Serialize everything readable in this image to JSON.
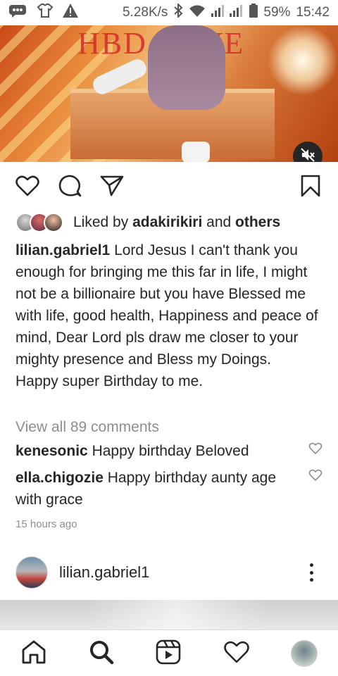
{
  "status_bar": {
    "speed": "5.28K/s",
    "battery": "59%",
    "time": "15:42",
    "icons": [
      "message-icon",
      "shirt-icon",
      "warning-icon",
      "bluetooth-icon",
      "wifi-icon",
      "signal-icon",
      "battery-icon"
    ]
  },
  "post": {
    "overlay_text": "HBD LOVE",
    "mute_icon": "volume-off-icon",
    "actions": {
      "like_icon": "heart-icon",
      "comment_icon": "comment-icon",
      "share_icon": "send-icon",
      "save_icon": "bookmark-icon"
    },
    "likes": {
      "prefix": "Liked by",
      "user": "adakirikiri",
      "and": "and",
      "others": "others"
    },
    "caption": {
      "username": "lilian.gabriel1",
      "text": "Lord Jesus I can't thank you enough for bringing me this far in life, I might not be a billionaire but you have Blessed me with life, good health, Happiness and peace of mind, Dear Lord pls draw me closer to your mighty presence and Bless my Doings.",
      "last_line": "Happy super Birthday to me."
    },
    "view_comments": "View all 89 comments",
    "comments": [
      {
        "username": "kenesonic",
        "text": "Happy birthday Beloved"
      },
      {
        "username": "ella.chigozie",
        "text": "Happy birthday aunty age with grace"
      }
    ],
    "timestamp": "15 hours ago"
  },
  "next_post": {
    "username": "lilian.gabriel1"
  },
  "bottom_nav": {
    "items": [
      "home-icon",
      "search-icon",
      "reels-icon",
      "activity-heart-icon",
      "profile-avatar"
    ]
  },
  "colors": {
    "text": "#262626",
    "muted": "#8e8e8e",
    "border": "#dbdbdb"
  }
}
